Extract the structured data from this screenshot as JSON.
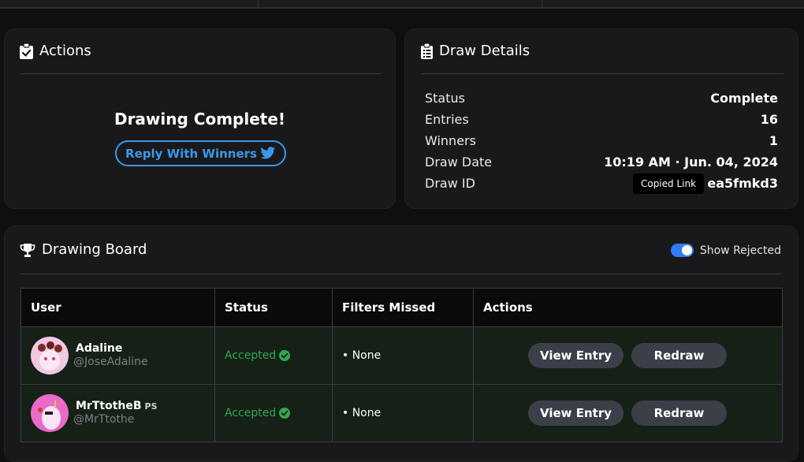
{
  "actions": {
    "title": "Actions",
    "complete_text": "Drawing Complete!",
    "reply_button_label": "Reply With Winners",
    "icon": "clipboard-check-icon"
  },
  "draw_details": {
    "title": "Draw Details",
    "icon": "clipboard-list-icon",
    "rows": [
      {
        "label": "Status",
        "value": "Complete"
      },
      {
        "label": "Entries",
        "value": "16"
      },
      {
        "label": "Winners",
        "value": "1"
      },
      {
        "label": "Draw Date",
        "value": "10:19 AM · Jun. 04, 2024"
      },
      {
        "label": "Draw ID",
        "value": "ea5fmkd3"
      }
    ],
    "tooltip": "Copied Link"
  },
  "board": {
    "title": "Drawing Board",
    "icon": "trophy-icon",
    "toggle_label": "Show Rejected",
    "toggle_on": true,
    "columns": [
      "User",
      "Status",
      "Filters Missed",
      "Actions"
    ],
    "rows": [
      {
        "name": "Adaline",
        "badge": "",
        "handle": "@JoseAdaline",
        "status": "Accepted",
        "filters": "• None",
        "view_label": "View Entry",
        "redraw_label": "Redraw"
      },
      {
        "name": "MrTtotheB",
        "badge": "PS",
        "handle": "@MrTtothe",
        "status": "Accepted",
        "filters": "• None",
        "view_label": "View Entry",
        "redraw_label": "Redraw"
      }
    ]
  },
  "colors": {
    "accent_blue": "#3b97ea",
    "accepted_green": "#2fa84f",
    "row_bg": "#152017",
    "toggle_blue": "#2f7cf6"
  }
}
